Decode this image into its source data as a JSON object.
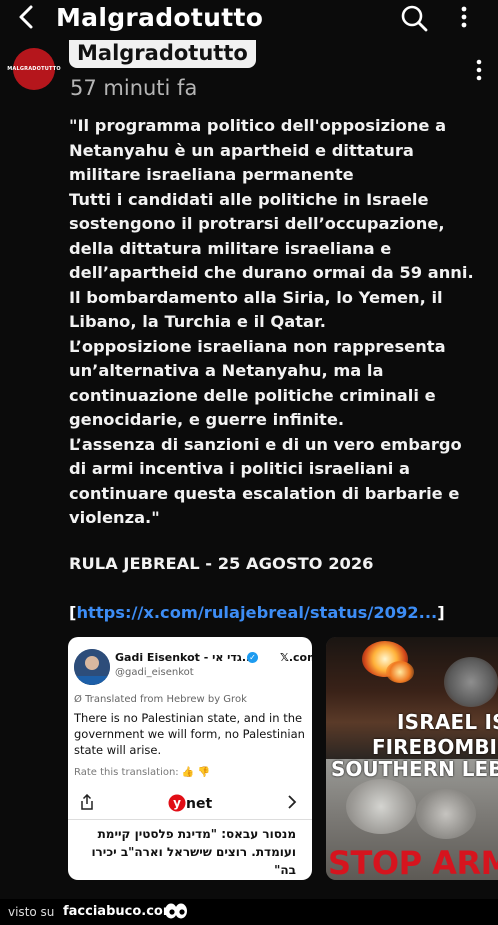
{
  "header": {
    "title": "Malgradotutto",
    "back_icon": "chevron-left-icon",
    "search_icon": "search-icon",
    "more_icon": "kebab-menu-icon"
  },
  "post": {
    "avatar_label": "MALGRADOTUTTO",
    "page_name": "Malgradotutto",
    "time": "57 minuti fa",
    "lines": [
      "\"Il programma politico dell'opposizione a",
      "Netanyahu è un apartheid e dittatura",
      "militare israeliana permanente",
      "Tutti i candidati alle politiche in Israele",
      "sostengono il protrarsi dell’occupazione,",
      "della dittatura militare israeliana e",
      "dell’apartheid che durano ormai da 59 anni.",
      "Il bombardamento alla Siria, lo Yemen, il",
      "Libano, la Turchia e il Qatar.",
      "L’opposizione israeliana non rappresenta",
      "un’alternativa a Netanyahu, ma la",
      "continuazione delle politiche criminali e",
      "genocidarie, e guerre infinite.",
      "L’assenza di sanzioni e di un vero embargo",
      "di armi incentiva i politici israeliani a",
      "continuare questa escalation di barbarie e",
      "violenza.\""
    ],
    "signature": "RULA JEBREAL - 25 AGOSTO 2026",
    "link_open": "[",
    "link_url": "https://x.com/rulajebreal/status/2092...",
    "link_close": "]"
  },
  "tweet_card": {
    "name": "Gadi Eisenkot - גדי אי...",
    "x_label": "𝕏.com",
    "handle": "@gadi_eisenkot",
    "translated_label": "Translated from Hebrew by Grok",
    "translation": "There is no Palestinian state, and in the government we will form, no Palestinian state will arise.",
    "rate_label": "Rate this translation:",
    "logo_text": "ynet",
    "hebrew_text": "מנסור עבאס: \"מדינת פלסטין קיימת ועומדת. רוצים שישראל וארה\"ב יכירו בה\""
  },
  "image_card": {
    "line1": "ISRAEL IS",
    "line2": "FIREBOMBIN",
    "line3": "SOUTHERN LEB",
    "stop_text": "STOP ARM"
  },
  "footer": {
    "visto": "visto su",
    "site": "facciabuco.com"
  },
  "colors": {
    "background": "#0b0b0b",
    "link": "#3d8df5",
    "avatar": "#b5161c",
    "stop": "#d6141e"
  }
}
